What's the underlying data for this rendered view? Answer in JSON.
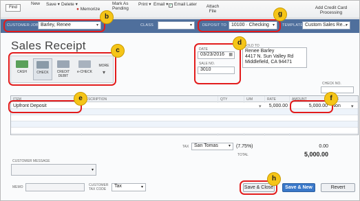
{
  "toolbar": {
    "find": "Find",
    "new": "New",
    "save": "Save",
    "delete": "Delete",
    "memorize": "Memorize",
    "mark_as_pending": "Mark As Pending",
    "print": "Print",
    "email": "Email",
    "email_later": "Email Later",
    "attach_file": "Attach File",
    "add_credit_card": "Add Credit Card Processing"
  },
  "header": {
    "customer_job_label": "CUSTOMER:JOB",
    "customer_job_value": "Barley, Renee",
    "class_label": "CLASS",
    "class_value": "",
    "deposit_to_label": "DEPOSIT TO",
    "deposit_to_value": "10100 · Checking",
    "template_label": "TEMPLATE",
    "template_value": "Custom Sales Re..."
  },
  "form": {
    "title": "Sales Receipt",
    "date_label": "DATE",
    "date_value": "03/23/2016",
    "sale_no_label": "SALE NO.",
    "sale_no_value": "3010",
    "sold_to_label": "SOLD TO",
    "sold_to_lines": [
      "Renee Barley",
      "4417 N. Sun Valley Rd",
      "Middlefield, CA 94471"
    ],
    "check_no_label": "CHECK NO.",
    "payment_methods": [
      {
        "label": "CASH",
        "color": "#5aa05a"
      },
      {
        "label": "CHECK",
        "color": "#8a9aa8"
      },
      {
        "label": "CREDIT DEBIT",
        "color": "#9aa6b4"
      },
      {
        "label": "e-CHECK",
        "color": "#a8b2be"
      },
      {
        "label": "MORE",
        "color": "#6b7a8c"
      }
    ]
  },
  "grid": {
    "columns": [
      "ITEM",
      "DESCRIPTION",
      "QTY",
      "U/M",
      "RATE",
      "AMOUNT",
      "TAX"
    ],
    "rows": [
      {
        "item": "Upfront Deposit",
        "description": "",
        "qty": "",
        "um": "",
        "rate": "5,000.00",
        "amount": "5,000.00",
        "tax": "Non"
      }
    ]
  },
  "footer": {
    "tax_label": "TAX",
    "tax_value": "San Tomas",
    "tax_rate": "(7.75%)",
    "tax_amount": "0.00",
    "total_label": "TOTAL",
    "total_value": "5,000.00",
    "customer_message_label": "CUSTOMER MESSAGE",
    "memo_label": "MEMO",
    "customer_tax_code_label": "CUSTOMER TAX CODE",
    "customer_tax_code_value": "Tax",
    "save_close": "Save & Close",
    "save_new": "Save & New",
    "revert": "Revert"
  },
  "callouts": [
    "b",
    "c",
    "d",
    "e",
    "f",
    "g",
    "h"
  ],
  "colors": {
    "header_bar": "#4f6f9c",
    "callout_fill": "#f5c518",
    "callout_outline": "#e21b1b",
    "primary_button": "#3a78c9"
  }
}
